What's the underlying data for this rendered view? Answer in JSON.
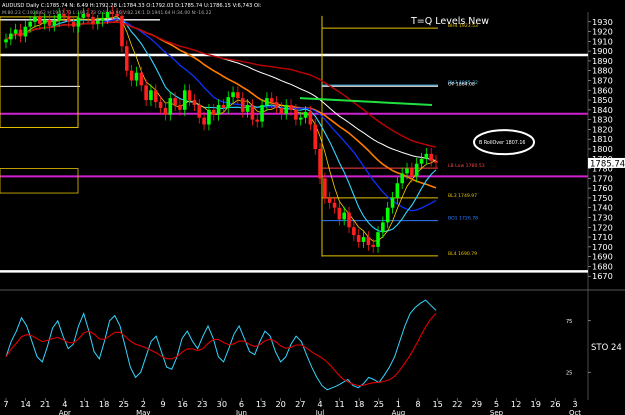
{
  "header": {
    "symbol_line": "AUDUSD Daily C:1785.74 N: 6.49 H:1792.28 L:1784.33 O:1792.03 D:1785.74 U:1786.15 V:6,743 OI:",
    "subline": "M:80:23 C:1928.62 H:1947.73 L:1913.73 O:1942.96 V:82.1K:1 D:1941.64 H:34.00 N:-16.22"
  },
  "chart_data": {
    "type": "candlestick",
    "title": "T=Q Levels New",
    "ylim": [
      1660,
      1940
    ],
    "last_price_label": "1785.74",
    "y_ticks": [
      1930,
      1920,
      1910,
      1900,
      1890,
      1880,
      1870,
      1860,
      1850,
      1840,
      1830,
      1820,
      1810,
      1800,
      1790,
      1780,
      1770,
      1760,
      1750,
      1740,
      1730,
      1720,
      1710,
      1700,
      1690,
      1680,
      1670
    ],
    "x_tick_labels": [
      "7",
      "14",
      "21",
      "4",
      "11",
      "18",
      "25",
      "2",
      "9",
      "16",
      "23",
      "30",
      "6",
      "13",
      "20",
      "27",
      "4",
      "11",
      "18",
      "25",
      "1",
      "8",
      "15",
      "22",
      "29",
      "5",
      "12",
      "19",
      "26",
      "3"
    ],
    "month_labels": [
      "Apr",
      "May",
      "Jun",
      "Jul",
      "Aug",
      "Sep",
      "Oct"
    ],
    "levels": [
      {
        "label": "BH4 1923.53",
        "value": 1923.5,
        "color": "#e6c200"
      },
      {
        "label": "BH3 1865.32",
        "value": 1865.3,
        "color": "#4fc3f7"
      },
      {
        "label": "OP 1864.08",
        "value": 1864.1,
        "color": "#ffffff"
      },
      {
        "label": "LB Low 1780.53",
        "value": 1780.5,
        "color": "#ff4040"
      },
      {
        "label": "BL3 1749.97",
        "value": 1750.0,
        "color": "#e6c200"
      },
      {
        "label": "BO1 1726.78",
        "value": 1726.8,
        "color": "#2e7dff"
      },
      {
        "label": "BL4 1690.79",
        "value": 1690.8,
        "color": "#e6c200"
      }
    ],
    "annotation": "B RollOver 1807.16",
    "series": [
      {
        "name": "close",
        "values": [
          1912,
          1918,
          1922,
          1915,
          1925,
          1930,
          1935,
          1928,
          1932,
          1926,
          1931,
          1938,
          1936,
          1930,
          1925,
          1934,
          1938,
          1935,
          1928,
          1931,
          1934,
          1940,
          1938,
          1936,
          1905,
          1880,
          1870,
          1878,
          1865,
          1850,
          1860,
          1848,
          1842,
          1835,
          1852,
          1845,
          1840,
          1860,
          1850,
          1845,
          1832,
          1825,
          1840,
          1835,
          1845,
          1842,
          1853,
          1858,
          1852,
          1838,
          1845,
          1830,
          1828,
          1845,
          1852,
          1848,
          1842,
          1836,
          1845,
          1840,
          1830,
          1832,
          1838,
          1825,
          1800,
          1770,
          1750,
          1745,
          1740,
          1728,
          1735,
          1720,
          1712,
          1705,
          1710,
          1702,
          1700,
          1715,
          1725,
          1740,
          1750,
          1765,
          1775,
          1780,
          1772,
          1785,
          1790,
          1795,
          1788,
          1786
        ]
      },
      {
        "name": "stochastic",
        "values": [
          40,
          55,
          65,
          78,
          70,
          55,
          40,
          35,
          50,
          68,
          75,
          60,
          48,
          52,
          70,
          82,
          65,
          45,
          38,
          55,
          75,
          80,
          70,
          50,
          30,
          20,
          25,
          40,
          55,
          60,
          45,
          30,
          28,
          40,
          58,
          65,
          55,
          48,
          60,
          70,
          58,
          40,
          35,
          48,
          62,
          70,
          58,
          45,
          42,
          55,
          65,
          60,
          45,
          35,
          40,
          52,
          60,
          55,
          42,
          30,
          20,
          12,
          8,
          10,
          12,
          15,
          18,
          12,
          10,
          14,
          20,
          18,
          15,
          22,
          30,
          40,
          55,
          70,
          82,
          88,
          92,
          95,
          90,
          85
        ]
      }
    ],
    "stochastic_label": "STO 24",
    "stochastic_ticks": [
      25,
      75
    ]
  }
}
